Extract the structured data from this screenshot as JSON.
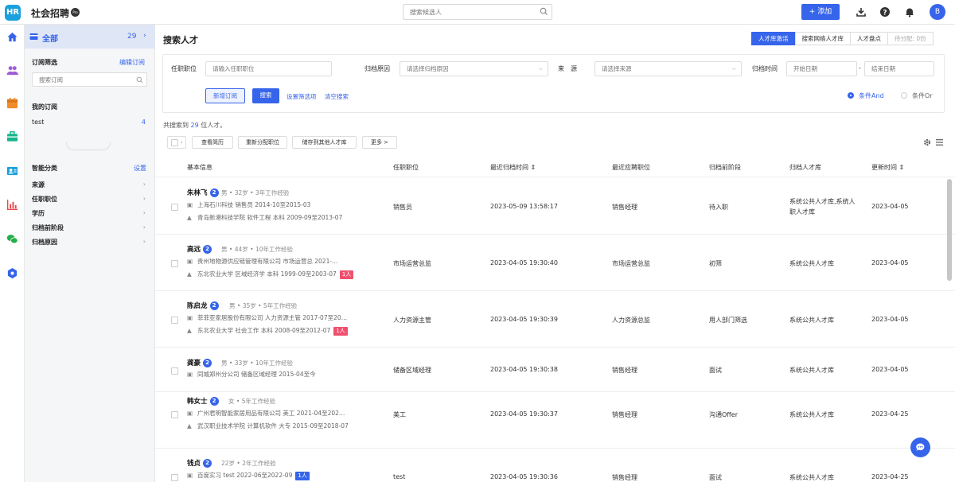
{
  "app": {
    "logo_text": "HR",
    "title": "社会招聘",
    "title_badge": "Pro"
  },
  "topbar": {
    "search_placeholder": "搜索候选人",
    "add_label": "+ 添加",
    "avatar_letter": "B"
  },
  "sidebar": {
    "all_label": "全部",
    "all_count": "29",
    "subscription_filter_label": "订阅筛选",
    "edit_subscription_label": "编辑订阅",
    "search_placeholder": "搜索订阅",
    "my_subscription_label": "我的订阅",
    "subscriptions": [
      {
        "name": "test",
        "count": "4"
      }
    ],
    "smart_category_label": "智能分类",
    "settings_label": "设置",
    "categories": [
      "来源",
      "任职职位",
      "学历",
      "归档前阶段",
      "归档原因"
    ]
  },
  "main": {
    "page_title": "搜索人才",
    "tabs": [
      "人才库激活",
      "搜索网络人才库",
      "人才盘点",
      "待分配: 0份"
    ],
    "filters": {
      "position_label": "任职职位",
      "position_placeholder": "请输入任职职位",
      "reason_label": "归档原因",
      "reason_placeholder": "请选择归档原因",
      "source_label": "来　源",
      "source_placeholder": "请选择来源",
      "time_label": "归档时间",
      "start_placeholder": "开始日期",
      "end_placeholder": "结束日期",
      "date_sep": "-"
    },
    "buttons": {
      "new_subscription": "新增订阅",
      "search": "搜索",
      "set_filter": "设置筛选项",
      "clear": "清空搜索"
    },
    "radios": {
      "and": "条件And",
      "or": "条件Or"
    },
    "summary": {
      "prefix": "共搜索到 ",
      "count": "29",
      "suffix": " 位人才。"
    },
    "actions": [
      "查看简历",
      "重新分配职位",
      "储存到其他人才库",
      "更多 >"
    ],
    "columns": [
      "基本信息",
      "任职职位",
      "最近归档时间 ⇕",
      "最近应聘职位",
      "归档前阶段",
      "归档人才库",
      "更新时间 ⇕"
    ]
  },
  "rows": [
    {
      "name": "朱林飞",
      "badge": "2",
      "meta": "男 • 32岁 • 3年工作经验",
      "work": "上海石川科技 销售员 2014-10至2015-03",
      "edu": "青岛新港科技学院 软件工程 本科 2009-09至2013-07",
      "tag": "",
      "position": "销售员",
      "archived": "2023-05-09 13:58:17",
      "applied": "销售经理",
      "stage": "待入职",
      "pool": "系统公共人才库,系统人",
      "pool2": "职人才库",
      "updated": "2023-04-05"
    },
    {
      "name": "高远",
      "badge": "2",
      "meta": "男 • 44岁 • 10年工作经验",
      "work": "贵州地物源供应链管理有限公司 市场运营总 2021-…",
      "edu": "东北农业大学 区域经济学 本科 1999-09至2003-07",
      "tag": "1人",
      "position": "市场运营总监",
      "archived": "2023-04-05 19:30:40",
      "applied": "市场运营总监",
      "stage": "初筛",
      "pool": "系统公共人才库",
      "pool2": "",
      "updated": "2023-04-05"
    },
    {
      "name": "陈启龙",
      "badge": "2",
      "meta": "男 • 35岁 • 5年工作经验",
      "work": "菲菲亚家居股份有限公司 人力资源主管 2017-07至20…",
      "edu": "东北农业大学 社会工作 本科 2008-09至2012-07",
      "tag": "1人",
      "position": "人力资源主管",
      "archived": "2023-04-05 19:30:39",
      "applied": "人力资源总监",
      "stage": "用人部门筛选",
      "pool": "系统公共人才库",
      "pool2": "",
      "updated": "2023-04-05"
    },
    {
      "name": "龚豪",
      "badge": "2",
      "meta": "男 • 33岁 • 10年工作经验",
      "work": "同城郑州分公司 储备区域经理 2015-04至今",
      "edu": "",
      "tag": "",
      "position": "储备区域经理",
      "archived": "2023-04-05 19:30:38",
      "applied": "销售经理",
      "stage": "面试",
      "pool": "系统公共人才库",
      "pool2": "",
      "updated": "2023-04-05"
    },
    {
      "name": "韩女士",
      "badge": "2",
      "meta": "女 • 5年工作经验",
      "work": "广州君明智能家居用品有限公司 美工 2021-04至202…",
      "edu": "武汉职业技术学院 计算机软件 大专 2015-09至2018-07",
      "tag": "",
      "position": "美工",
      "archived": "2023-04-05 19:30:37",
      "applied": "销售经理",
      "stage": "沟通Offer",
      "pool": "系统公共人才库",
      "pool2": "",
      "updated": "2023-04-25"
    },
    {
      "name": "钱贞",
      "badge": "2",
      "meta": "22岁 • 2年工作经验",
      "work": "百度实习 test 2022-06至2022-09",
      "edu": "",
      "tag": "1人",
      "position": "test",
      "archived": "2023-04-05 19:30:36",
      "applied": "销售经理",
      "stage": "面试",
      "pool": "系统公共人才库",
      "pool2": "",
      "updated": "2023-04-25"
    }
  ]
}
